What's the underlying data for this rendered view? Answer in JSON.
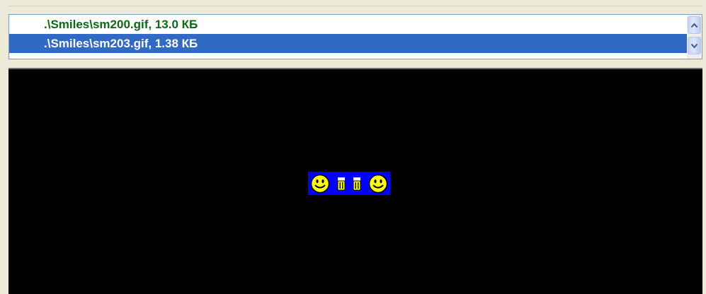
{
  "files": [
    {
      "label": ".\\Smiles\\sm200.gif, 13.0 КБ",
      "selected": false
    },
    {
      "label": ".\\Smiles\\sm203.gif, 1.38 КБ",
      "selected": true
    }
  ],
  "scroll": {
    "up_icon": "chevron-up-icon",
    "down_icon": "chevron-down-icon"
  },
  "preview": {
    "background": "#000000",
    "image_background": "#0000ff",
    "icons": [
      "smiley-icon",
      "beer-mug-icon",
      "beer-mug-icon",
      "smiley-icon"
    ]
  },
  "colors": {
    "row_text": "#0a6a14",
    "selection": "#316ac5",
    "smiley": "#ffff00"
  }
}
